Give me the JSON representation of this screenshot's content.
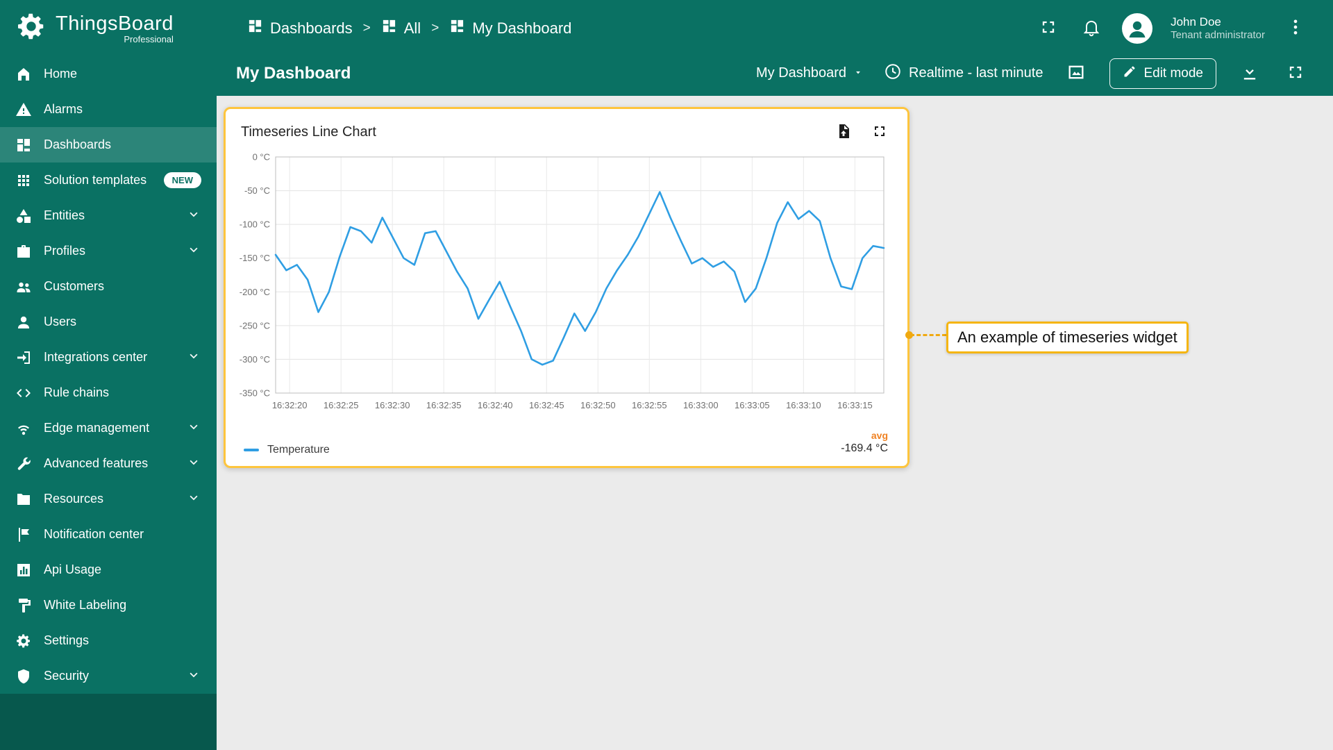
{
  "brand": {
    "name": "ThingsBoard",
    "subtitle": "Professional",
    "logo_icon": "gear"
  },
  "colors": {
    "primary_teal": "#0a7163",
    "sidebar_footer": "#07584d",
    "content_bg": "#ebebeb",
    "highlight_amber": "#fec53d",
    "annotation_border": "#f5b50e",
    "connector_orange": "#f0a911",
    "series_blue": "#2f9ee3",
    "agg_orange": "#ef8122"
  },
  "sidebar": {
    "items": [
      {
        "label": "Home",
        "icon": "home"
      },
      {
        "label": "Alarms",
        "icon": "alarm"
      },
      {
        "label": "Dashboards",
        "icon": "dashboards",
        "selected": true
      },
      {
        "label": "Solution templates",
        "icon": "apps",
        "badge": "NEW"
      },
      {
        "label": "Entities",
        "icon": "entities",
        "chevron": true
      },
      {
        "label": "Profiles",
        "icon": "profiles",
        "chevron": true
      },
      {
        "label": "Customers",
        "icon": "customers"
      },
      {
        "label": "Users",
        "icon": "users"
      },
      {
        "label": "Integrations center",
        "icon": "integrations",
        "chevron": true
      },
      {
        "label": "Rule chains",
        "icon": "rule-chains"
      },
      {
        "label": "Edge management",
        "icon": "edge",
        "chevron": true
      },
      {
        "label": "Advanced features",
        "icon": "advanced",
        "chevron": true
      },
      {
        "label": "Resources",
        "icon": "resources",
        "chevron": true
      },
      {
        "label": "Notification center",
        "icon": "notification"
      },
      {
        "label": "Api Usage",
        "icon": "api-usage"
      },
      {
        "label": "White Labeling",
        "icon": "white-labeling"
      },
      {
        "label": "Settings",
        "icon": "settings"
      },
      {
        "label": "Security",
        "icon": "security",
        "chevron": true
      }
    ]
  },
  "breadcrumb": {
    "separator": ">",
    "items": [
      {
        "label": "Dashboards",
        "icon": "dashboards"
      },
      {
        "label": "All",
        "icon": "dashboards"
      },
      {
        "label": "My Dashboard",
        "icon": "dashboards"
      }
    ]
  },
  "header": {
    "icons": [
      "fullscreen",
      "notifications",
      "avatar",
      "more-menu"
    ],
    "user": {
      "name": "John Doe",
      "role": "Tenant administrator"
    }
  },
  "toolbar": {
    "title": "My Dashboard",
    "dashboard_select": "My Dashboard",
    "time_window": "Realtime - last minute",
    "edit_label": "Edit mode",
    "icons": [
      "time-window-clock",
      "background-image",
      "edit-pencil",
      "download",
      "fullscreen"
    ]
  },
  "widget": {
    "title": "Timeseries Line Chart",
    "icons": [
      "export-data",
      "fullscreen"
    ],
    "legend": {
      "series": "Temperature",
      "agg_label": "avg",
      "agg_value": "-169.4 °C"
    }
  },
  "annotation": {
    "text": "An example of timeseries widget"
  },
  "chart_data": {
    "type": "line",
    "title": "Timeseries Line Chart",
    "grid": true,
    "legend_position": "bottom",
    "ylim": [
      -350,
      0
    ],
    "y_tick_labels": [
      "0 °C",
      "-50 °C",
      "-100 °C",
      "-150 °C",
      "-200 °C",
      "-250 °C",
      "-300 °C",
      "-350 °C"
    ],
    "x_tick_labels": [
      "16:32:20",
      "16:32:25",
      "16:32:30",
      "16:32:35",
      "16:32:40",
      "16:32:45",
      "16:32:50",
      "16:32:55",
      "16:33:00",
      "16:33:05",
      "16:33:10",
      "16:33:15"
    ],
    "x_range": [
      "16:32:18",
      "16:33:18"
    ],
    "x_tick_start_frac": 0.023,
    "x_tick_step_frac": 0.0845,
    "aggregation": {
      "label": "avg",
      "value": "-169.4 °C"
    },
    "series": [
      {
        "name": "Temperature",
        "unit": "°C",
        "color": "#2f9ee3",
        "values": [
          -145,
          -168,
          -160,
          -182,
          -230,
          -200,
          -148,
          -104,
          -110,
          -127,
          -90,
          -120,
          -150,
          -160,
          -113,
          -110,
          -140,
          -170,
          -195,
          -240,
          -212,
          -185,
          -222,
          -258,
          -300,
          -308,
          -302,
          -268,
          -232,
          -258,
          -230,
          -195,
          -168,
          -145,
          -118,
          -85,
          -52,
          -90,
          -125,
          -158,
          -150,
          -163,
          -155,
          -170,
          -215,
          -195,
          -150,
          -98,
          -67,
          -92,
          -80,
          -95,
          -150,
          -192,
          -196,
          -150,
          -132,
          -135
        ]
      }
    ]
  }
}
